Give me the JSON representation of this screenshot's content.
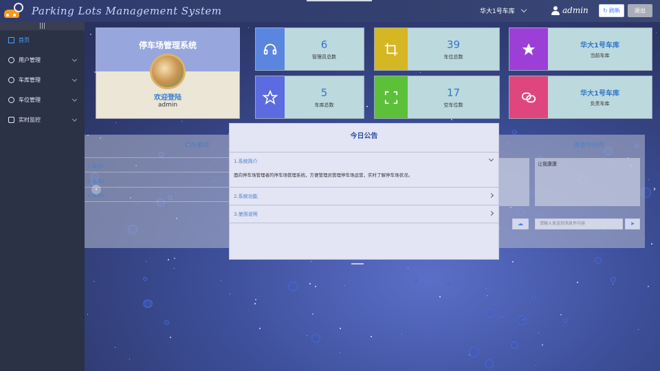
{
  "header": {
    "app_title": "Parking Lots Management System",
    "garage_select": "华大1号车库",
    "user_name": "admin",
    "refresh_label": "刷新",
    "logout_label": "退出"
  },
  "sidebar": {
    "toggle": "|||",
    "items": [
      {
        "label": "首页",
        "active": true
      },
      {
        "label": "用户管理"
      },
      {
        "label": "车库管理"
      },
      {
        "label": "车位管理"
      },
      {
        "label": "实时监控"
      }
    ]
  },
  "welcome": {
    "title": "停车场管理系统",
    "greeting": "欢迎登陆",
    "user": "admin"
  },
  "stats": [
    {
      "value": "6",
      "label": "管理员总数",
      "color": "#5b86e0",
      "icon": "headset-icon"
    },
    {
      "value": "39",
      "label": "车位总数",
      "color": "#d4b722",
      "icon": "crop-icon"
    },
    {
      "value": "华大1号车库",
      "label": "当前车库",
      "color": "#9b3fd6",
      "icon": "star-filled-icon"
    },
    {
      "value": "5",
      "label": "车库总数",
      "color": "#5d6be0",
      "icon": "star-outline-icon"
    },
    {
      "value": "17",
      "label": "空车位数",
      "color": "#5cc038",
      "icon": "fullscreen-icon"
    },
    {
      "value": "华大1号车库",
      "label": "负责车库",
      "color": "#e0467e",
      "icon": "link-icon"
    }
  ],
  "todo": {
    "title": "待办事项",
    "items": [
      "1.事项1",
      "2.事项2",
      "3.事项3"
    ]
  },
  "messages": {
    "title": "消息中间件",
    "text": "让我康康",
    "input_placeholder": "请输入发送到消息件内容"
  },
  "notice": {
    "title": "今日公告",
    "sections": [
      {
        "heading": "1.系统简介",
        "expanded": true,
        "body": "面向停车场管理者的停车场管理系统，方便管理员管理停车场运营，实时了解停车场状况。"
      },
      {
        "heading": "2.系统功能",
        "expanded": false
      },
      {
        "heading": "3.使用说明",
        "expanded": false
      }
    ]
  },
  "colors": {
    "accent": "#4aa3ff",
    "sidebar_bg": "#2b3246",
    "header_bg": "#33406f",
    "stat_info_bg": "#bcd9de"
  }
}
